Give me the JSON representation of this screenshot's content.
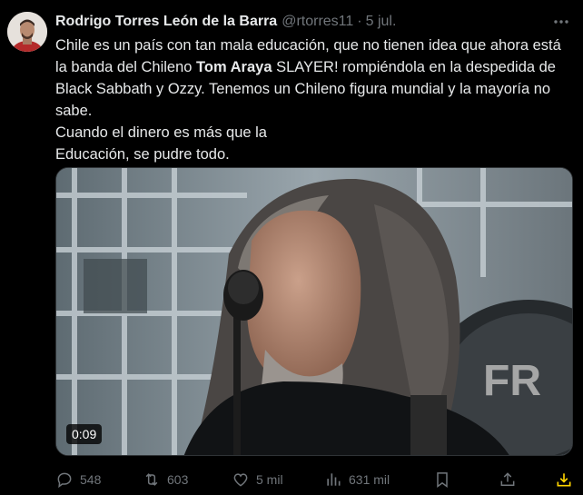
{
  "author": {
    "name": "Rodrigo Torres León de la Barra",
    "handle": "@rtorres11",
    "separator": "·",
    "time": "5 jul."
  },
  "tweet": {
    "lines": [
      [
        "Chile es un país con tan mala educación, que no tienen idea que ahora está"
      ],
      [
        "la banda del Chileno ",
        "Tom Araya",
        " SLAYER! rompiéndola en la despedida de"
      ],
      [
        "Black Sabbath y Ozzy. Tenemos un Chileno figura mundial y la mayoría no"
      ],
      [
        "sabe."
      ],
      [
        "Cuando el dinero es más que la"
      ],
      [
        "Educación, se pudre todo."
      ]
    ]
  },
  "media": {
    "type": "video",
    "duration": "0:09",
    "drum_text": "FR"
  },
  "actions": {
    "replies": "548",
    "reposts": "603",
    "likes": "5 mil",
    "views": "631 mil"
  },
  "icons": {
    "more": "more-icon",
    "reply": "reply-icon",
    "repost": "repost-icon",
    "like": "heart-icon",
    "views": "views-icon",
    "bookmark": "bookmark-icon",
    "share": "share-icon",
    "download": "download-icon"
  },
  "colors": {
    "background": "#000000",
    "text": "#e7e9ea",
    "secondary": "#71767b",
    "download_accent": "#ffd400"
  }
}
